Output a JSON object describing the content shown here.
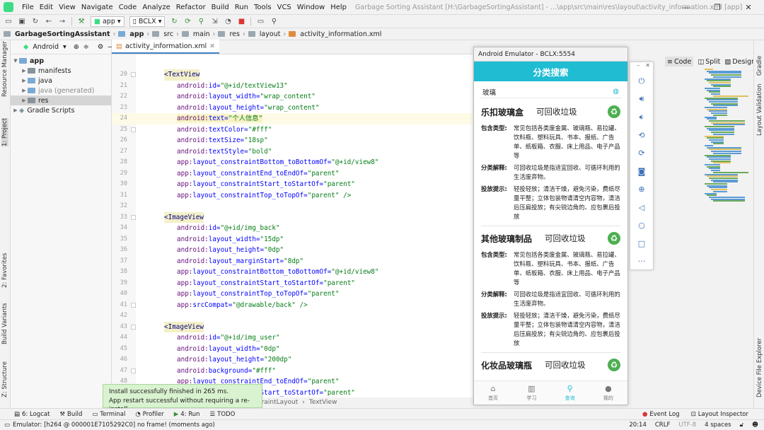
{
  "window": {
    "title": "Garbage Sorting Assistant [H:\\GarbageSortingAssistant] - ...\\app\\src\\main\\res\\layout\\activity_information.xml [app]",
    "minimize": "—",
    "maximize": "❐",
    "close": "✕"
  },
  "menu": [
    "File",
    "Edit",
    "View",
    "Navigate",
    "Code",
    "Analyze",
    "Refactor",
    "Build",
    "Run",
    "Tools",
    "VCS",
    "Window",
    "Help"
  ],
  "toolbar": {
    "run_config": "app",
    "device": "BCLX"
  },
  "breadcrumb": [
    "GarbageSortingAssistant",
    "app",
    "src",
    "main",
    "res",
    "layout",
    "activity_information.xml"
  ],
  "project_panel": {
    "view_mode": "Android",
    "tree": [
      {
        "label": "app",
        "level": 0,
        "bold": true
      },
      {
        "label": "manifests",
        "level": 1
      },
      {
        "label": "java",
        "level": 1
      },
      {
        "label": "java (generated)",
        "level": 1,
        "muted": true
      },
      {
        "label": "res",
        "level": 1,
        "selected": true
      },
      {
        "label": "Gradle Scripts",
        "level": 0
      }
    ]
  },
  "left_tools": [
    "Resource Manager",
    "1: Project",
    "2: Favorites",
    "Build Variants",
    "Z: Structure"
  ],
  "right_tools": [
    "Gradle",
    "Layout Validation",
    "Device File Explorer"
  ],
  "editor": {
    "tab": "activity_information.xml",
    "lines": [
      {
        "n": "20",
        "text": "<TextView",
        "kind": "tag"
      },
      {
        "n": "21",
        "ns": "android:",
        "attr": "id=",
        "val": "\"@+id/textView13\""
      },
      {
        "n": "22",
        "ns": "android:",
        "attr": "layout_width=",
        "val": "\"wrap_content\""
      },
      {
        "n": "23",
        "ns": "android:",
        "attr": "layout_height=",
        "val": "\"wrap_content\""
      },
      {
        "n": "24",
        "ns": "android:",
        "attr": "text=",
        "val": "\"个人信息\"",
        "highlight": true
      },
      {
        "n": "25",
        "ns": "android:",
        "attr": "textColor=",
        "val": "\"#fff\""
      },
      {
        "n": "26",
        "ns": "android:",
        "attr": "textSize=",
        "val": "\"18sp\""
      },
      {
        "n": "27",
        "ns": "android:",
        "attr": "textStyle=",
        "val": "\"bold\""
      },
      {
        "n": "28",
        "ns": "app:",
        "attr": "layout_constraintBottom_toBottomOf=",
        "val": "\"@+id/view8\""
      },
      {
        "n": "29",
        "ns": "app:",
        "attr": "layout_constraintEnd_toEndOf=",
        "val": "\"parent\""
      },
      {
        "n": "30",
        "ns": "app:",
        "attr": "layout_constraintStart_toStartOf=",
        "val": "\"parent\""
      },
      {
        "n": "31",
        "ns": "app:",
        "attr": "layout_constraintTop_toTopOf=",
        "val": "\"parent\" />"
      },
      {
        "n": "32",
        "text": "",
        "kind": "blank"
      },
      {
        "n": "33",
        "text": "<ImageView",
        "kind": "tag"
      },
      {
        "n": "34",
        "ns": "android:",
        "attr": "id=",
        "val": "\"@+id/img_back\""
      },
      {
        "n": "35",
        "ns": "android:",
        "attr": "layout_width=",
        "val": "\"15dp\""
      },
      {
        "n": "36",
        "ns": "android:",
        "attr": "layout_height=",
        "val": "\"0dp\""
      },
      {
        "n": "37",
        "ns": "android:",
        "attr": "layout_marginStart=",
        "val": "\"8dp\""
      },
      {
        "n": "38",
        "ns": "app:",
        "attr": "layout_constraintBottom_toBottomOf=",
        "val": "\"@+id/view8\""
      },
      {
        "n": "39",
        "ns": "app:",
        "attr": "layout_constraintStart_toStartOf=",
        "val": "\"parent\""
      },
      {
        "n": "40",
        "ns": "app:",
        "attr": "layout_constraintTop_toTopOf=",
        "val": "\"parent\""
      },
      {
        "n": "41",
        "ns": "app:",
        "attr": "srcCompat=",
        "val": "\"@drawable/back\" />"
      },
      {
        "n": "42",
        "text": "",
        "kind": "blank"
      },
      {
        "n": "43",
        "text": "<ImageView",
        "kind": "tag"
      },
      {
        "n": "44",
        "ns": "android:",
        "attr": "id=",
        "val": "\"@+id/img_user\""
      },
      {
        "n": "45",
        "ns": "android:",
        "attr": "layout_width=",
        "val": "\"0dp\""
      },
      {
        "n": "46",
        "ns": "android:",
        "attr": "layout_height=",
        "val": "\"200dp\""
      },
      {
        "n": "47",
        "ns": "android:",
        "attr": "background=",
        "val": "\"#fff\""
      },
      {
        "n": "48",
        "ns": "app:",
        "attr": "layout_constraintEnd_toEndOf=",
        "val": "\"parent\""
      },
      {
        "n": "49",
        "ns": "app:",
        "attr": "layout_constraintStart_toStartOf=",
        "val": "\"parent\""
      }
    ],
    "path": [
      "ConstraintLayout",
      "TextView"
    ]
  },
  "view_toggles": [
    "Code",
    "Split",
    "Design"
  ],
  "emulator": {
    "title": "Android Emulator - BCLX:5554",
    "app_header": "分类搜索",
    "search_value": "玻璃",
    "labels": {
      "type": "包含类型:",
      "explain": "分类解释:",
      "tips": "投放提示:"
    },
    "cards": [
      {
        "name": "乐扣玻璃盒",
        "category": "可回收垃圾",
        "type": "常见包括各类废金属、玻璃瓶、易拉罐、饮料瓶、塑料玩具、书本、报纸、广告单、纸板箱、衣服、床上用品、电子产品等",
        "explain": "可回收垃圾是指适宜回收、可循环利用的生活废弃物。",
        "tips": "轻投轻放；清洁干燥，避免污染，费纸尽量平整；立体包装物请清空内容物，清洁后压扁投放；有尖锐边角的、应包裹后投放"
      },
      {
        "name": "其他玻璃制品",
        "category": "可回收垃圾",
        "type": "常见包括各类废金属、玻璃瓶、易拉罐、饮料瓶、塑料玩具、书本、报纸、广告单、纸板箱、衣服、床上用品、电子产品等",
        "explain": "可回收垃圾是指适宜回收、可循环利用的生活废弃物。",
        "tips": "轻投轻放；清洁干燥，避免污染，费纸尽量平整；立体包装物请清空内容物，清洁后压扁投放；有尖锐边角的、应包裹后投放"
      },
      {
        "name": "化妆品玻璃瓶",
        "category": "可回收垃圾"
      }
    ],
    "nav": [
      {
        "label": "首页",
        "icon": "home-icon"
      },
      {
        "label": "学习",
        "icon": "book-icon"
      },
      {
        "label": "查询",
        "icon": "search-icon",
        "active": true
      },
      {
        "label": "我的",
        "icon": "user-icon"
      }
    ]
  },
  "toast": {
    "line1": "Install successfully finished in 265 ms.",
    "line2": "App restart successful without requiring a re-install."
  },
  "bottom_tools": [
    "6: Logcat",
    "Build",
    "Terminal",
    "Profiler",
    "4: Run",
    "TODO"
  ],
  "bottom_right_tools": [
    "Event Log",
    "Layout Inspector"
  ],
  "status": {
    "message": "Emulator: [h264 @ 000001E7105292C0] no frame! (moments ago)",
    "position": "20:14",
    "line_sep": "CRLF",
    "encoding": "UTF-8",
    "indent": "4 spaces"
  },
  "colors": {
    "accent": "#1fbcd2",
    "recycle": "#4caf50"
  }
}
